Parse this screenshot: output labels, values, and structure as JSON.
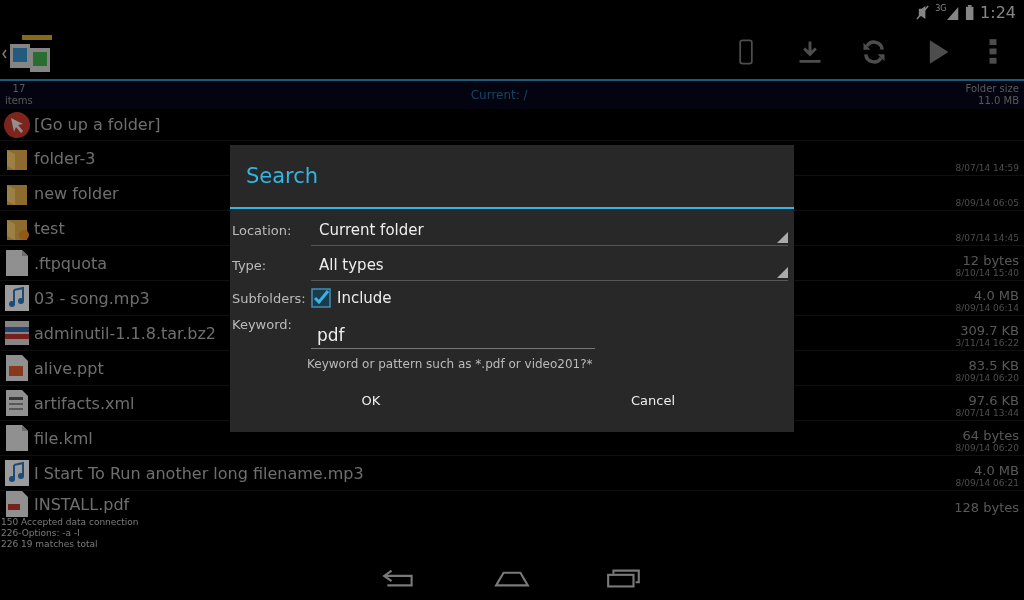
{
  "status_bar": {
    "time": "1:24",
    "network": "3G"
  },
  "header": {
    "item_count": "17",
    "item_label": "items",
    "current_path": "Current: /",
    "folder_size_label": "Folder size",
    "folder_size": "11.0 MB"
  },
  "files": [
    {
      "kind": "up",
      "name": "[Go up a folder]"
    },
    {
      "kind": "folder",
      "name": "folder-3",
      "date": "8/07/14 14:59"
    },
    {
      "kind": "folder",
      "name": "new folder",
      "date": "8/09/14 06:05"
    },
    {
      "kind": "link-folder",
      "name": "test",
      "date": "8/07/14 14:45"
    },
    {
      "kind": "document",
      "name": ".ftpquota",
      "size": "12 bytes",
      "date": "8/10/14 15:40"
    },
    {
      "kind": "audio",
      "name": "03 - song.mp3",
      "size": "4.0 MB",
      "date": "8/09/14 06:14"
    },
    {
      "kind": "archive",
      "name": "adminutil-1.1.8.tar.bz2",
      "size": "309.7 KB",
      "date": "3/11/14 16:22"
    },
    {
      "kind": "presentation",
      "name": "alive.ppt",
      "size": "83.5 KB",
      "date": "8/09/14 06:20"
    },
    {
      "kind": "xml",
      "name": "artifacts.xml",
      "size": "97.6 KB",
      "date": "8/07/14 13:44"
    },
    {
      "kind": "document",
      "name": "file.kml",
      "size": "64 bytes",
      "date": "8/09/14 06:20"
    },
    {
      "kind": "audio",
      "name": "I Start To Run another long filename.mp3",
      "size": "4.0 MB",
      "date": "8/09/14 06:21"
    },
    {
      "kind": "pdf",
      "name": "INSTALL.pdf",
      "size": "128 bytes"
    }
  ],
  "log": [
    "150 Accepted data connection",
    "226-Options: -a -l",
    "226 19 matches total"
  ],
  "dialog": {
    "title": "Search",
    "location": {
      "label": "Location:",
      "value": "Current folder"
    },
    "type": {
      "label": "Type:",
      "value": "All types"
    },
    "subfolders": {
      "label": "Subfolders:",
      "option": "Include",
      "checked": true
    },
    "keyword": {
      "label": "Keyword:",
      "value": "pdf",
      "hint": "Keyword or pattern such as *.pdf or video201?*"
    },
    "buttons": [
      "OK",
      "Cancel"
    ]
  }
}
